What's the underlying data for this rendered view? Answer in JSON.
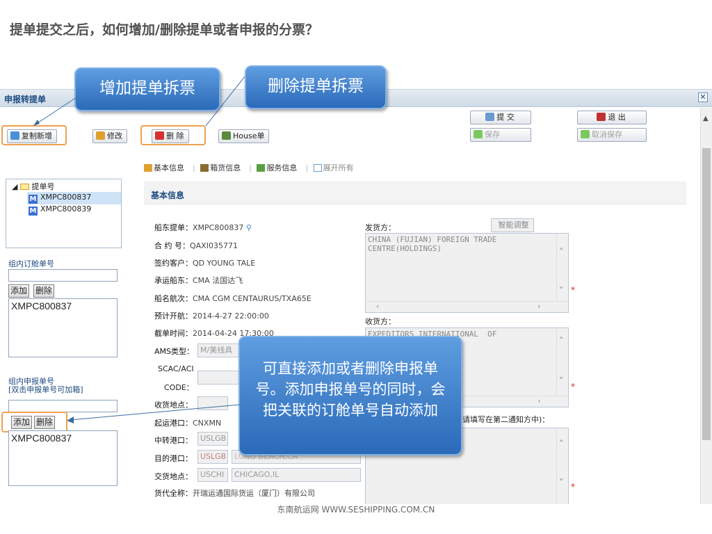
{
  "heading": "提单提交之后，如何增加/删除提单或者申报的分票？",
  "window": {
    "title": "申报转提单",
    "close": "✕"
  },
  "toolbar": {
    "copy_new": "复制新增",
    "modify": "修改",
    "delete": "删 除",
    "house": "House单",
    "submit": "提 交",
    "exit": "退 出",
    "save": "保存",
    "cancel_save": "取消保存"
  },
  "tabs": [
    "基本信息",
    "箱货信息",
    "服务信息",
    "展开所有"
  ],
  "tree": {
    "root": "提单号",
    "items": [
      "XMPC800837",
      "XMPC800839"
    ],
    "badge": "M"
  },
  "booking_group": {
    "label": "组内订舱单号",
    "add": "添加",
    "delete": "删除",
    "items": [
      "XMPC800837"
    ]
  },
  "declare_group": {
    "label_line1": "组内申报单号",
    "label_line2": "[双击申报单号可加箱]",
    "add": "添加",
    "delete": "删除",
    "items": [
      "XMPC800837"
    ]
  },
  "section_title": "基本信息",
  "fields": {
    "bl_label": "船东提单：",
    "bl_value": "XMPC800837",
    "contract_label": "合 约 号：",
    "contract_value": "QAXI035771",
    "client_label": "签约客户：",
    "client_value": "QD YOUNG TALE",
    "carrier_label": "承运船东：",
    "carrier_value": "CMA  法国达飞",
    "vessel_label": "船名航次：",
    "vessel_value": "CMA CGM CENTAURUS/TXA65E",
    "etd_label": "预计开航：",
    "etd_value": "2014-4-27 22:00:00",
    "cutoff_label": "截单时间：",
    "cutoff_value": "2014-04-24 17:30:00",
    "ams_label": "AMS类型：",
    "ams_value": "M/美线具",
    "scac_label1": "SCAC/ACI",
    "scac_label2": "CODE：",
    "receipt_label": "收货地点：",
    "pol_label": "起运港口：",
    "pol_value": "CNXMN",
    "transit_label": "中转港口：",
    "transit_code": "USLGB",
    "pod_label": "目的港口：",
    "pod_code": "USLGB",
    "pod_name": "LONG BEACH,CA",
    "delivery_label": "交货地点：",
    "delivery_code": "USCHI",
    "delivery_name": "CHICAGO,IL",
    "forwarder_label": "货代全称：",
    "forwarder_value": "开瑞运通国际货运（厦门）有限公司"
  },
  "shipper": {
    "label": "发货方：",
    "smart_button": "智能调整",
    "text": "CHINA (FUJIAN) FOREIGN TRADE\nCENTRE(HOLDINGS)"
  },
  "consignee": {
    "label": "收货方：",
    "text": "EXPEDITORS INTERNATIONAL  OF"
  },
  "notify": {
    "label": "请填写在第二通知方中)："
  },
  "callouts": {
    "add_split": "增加提单拆票",
    "delete_split": "删除提单拆票",
    "note": "可直接添加或者删除申报单号。添加申报单号的同时，会把关联的订舱单号自动添加"
  },
  "footer": "东南航运网 WWW.SESHIPPING.COM.CN",
  "colors": {
    "accent": "#1c4a80",
    "highlight": "#f0a050",
    "callout": "#2a6ab8",
    "required": "#e02020"
  }
}
